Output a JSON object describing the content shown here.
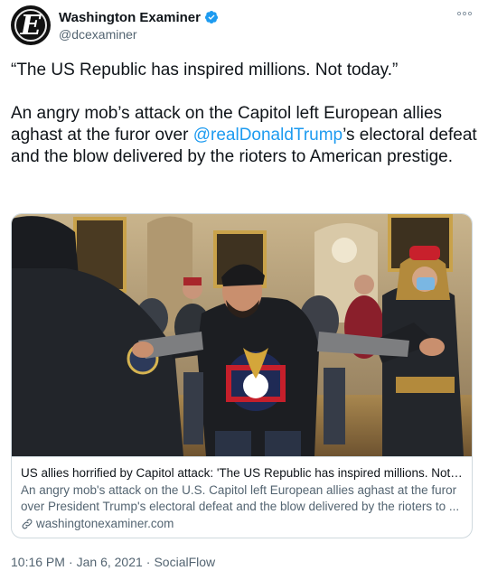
{
  "account": {
    "display_name": "Washington Examiner",
    "handle": "@dcexaminer",
    "avatar_icon": "washington-examiner-logo",
    "verified_icon": "verified-badge-icon",
    "verified_color": "#1d9bf0"
  },
  "tweet": {
    "paragraph1": "“The US Republic has inspired millions. Not today.”",
    "paragraph2_before": "An angry mob’s attack on the Capitol left European allies aghast at the furor over ",
    "mention": "@realDonaldTrump",
    "paragraph2_after": "’s electoral defeat and the blow delivered by the rioters to American prestige."
  },
  "card": {
    "title": "US allies horrified by Capitol attack: 'The US Republic has inspired millions. Not today'",
    "description": "An angry mob's attack on the U.S. Capitol left European allies aghast at the furor over President Trump's electoral defeat and the blow delivered by the rioters to ...",
    "domain": "washingtonexaminer.com",
    "link_icon": "link-icon"
  },
  "meta": {
    "time": "10:16 PM",
    "date": "Jan 6, 2021",
    "source": "SocialFlow",
    "separator": "·"
  },
  "more_icon": "more-options-icon",
  "colors": {
    "text": "#0f1419",
    "secondary": "#536471",
    "link": "#1d9bf0",
    "border": "#cfd9de"
  }
}
